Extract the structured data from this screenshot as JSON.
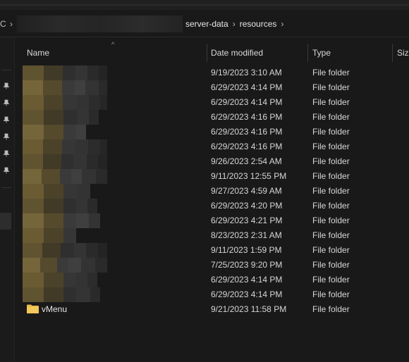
{
  "address": {
    "left_fragment": "C",
    "crumbs": [
      "server-data",
      "resources"
    ]
  },
  "columns": {
    "name": "Name",
    "date_modified": "Date modified",
    "type": "Type",
    "size": "Size"
  },
  "rows": [
    {
      "name": "",
      "date": "9/19/2023 3:10 AM",
      "type": "File folder"
    },
    {
      "name": "",
      "date": "6/29/2023 4:14 PM",
      "type": "File folder"
    },
    {
      "name": "",
      "date": "6/29/2023 4:14 PM",
      "type": "File folder"
    },
    {
      "name": "",
      "date": "6/29/2023 4:16 PM",
      "type": "File folder"
    },
    {
      "name": "",
      "date": "6/29/2023 4:16 PM",
      "type": "File folder"
    },
    {
      "name": "",
      "date": "6/29/2023 4:16 PM",
      "type": "File folder"
    },
    {
      "name": "",
      "date": "9/26/2023 2:54 AM",
      "type": "File folder"
    },
    {
      "name": "",
      "date": "9/11/2023 12:55 PM",
      "type": "File folder"
    },
    {
      "name": "",
      "date": "9/27/2023 4:59 AM",
      "type": "File folder"
    },
    {
      "name": "",
      "date": "6/29/2023 4:20 PM",
      "type": "File folder"
    },
    {
      "name": "",
      "date": "6/29/2023 4:21 PM",
      "type": "File folder"
    },
    {
      "name": "",
      "date": "8/23/2023 2:31 AM",
      "type": "File folder"
    },
    {
      "name": "",
      "date": "9/11/2023 1:59 PM",
      "type": "File folder"
    },
    {
      "name": "",
      "date": "7/25/2023 9:20 PM",
      "type": "File folder"
    },
    {
      "name": "",
      "date": "6/29/2023 4:14 PM",
      "type": "File folder"
    },
    {
      "name": "",
      "date": "6/29/2023 4:14 PM",
      "type": "File folder"
    },
    {
      "name": "vMenu",
      "date": "9/21/2023 11:58 PM",
      "type": "File folder"
    }
  ],
  "colors": {
    "background": "#191919",
    "folder_yellow": "#e8b84a",
    "text": "#d6d6d6"
  },
  "icons": {
    "nav_pin": "pin-icon",
    "folder": "folder-icon",
    "breadcrumb_separator": "chevron-right-icon",
    "sort": "sort-up-icon"
  }
}
